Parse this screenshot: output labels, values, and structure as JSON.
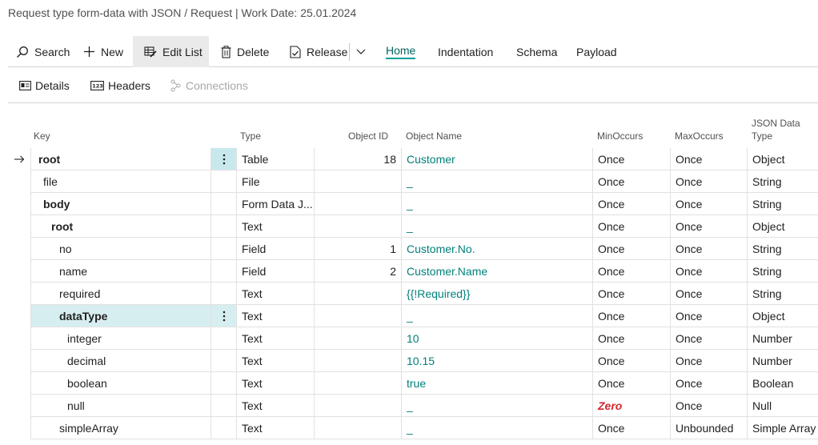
{
  "page": {
    "title": "Request type form-data with JSON / Request | Work Date: 25.01.2024"
  },
  "actions": {
    "search": "Search",
    "new": "New",
    "edit_list": "Edit List",
    "delete": "Delete",
    "release": "Release",
    "tabs": [
      "Home",
      "Indentation",
      "Schema",
      "Payload"
    ]
  },
  "subactions": {
    "details": "Details",
    "headers": "Headers",
    "connections": "Connections"
  },
  "columns": {
    "key": "Key",
    "type": "Type",
    "object_id": "Object ID",
    "object_name": "Object Name",
    "min_occurs": "MinOccurs",
    "max_occurs": "MaxOccurs",
    "json_data_type_1": "JSON Data",
    "json_data_type_2": "Type"
  },
  "rows": [
    {
      "key": "root",
      "type": "Table",
      "object_id": "18",
      "object_name": "Customer",
      "min": "Once",
      "max": "Once",
      "json": "Object"
    },
    {
      "key": "file",
      "type": "File",
      "object_id": "",
      "object_name": "_",
      "min": "Once",
      "max": "Once",
      "json": "String"
    },
    {
      "key": "body",
      "type": "Form Data J...",
      "object_id": "",
      "object_name": "_",
      "min": "Once",
      "max": "Once",
      "json": "String"
    },
    {
      "key": "root",
      "type": "Text",
      "object_id": "",
      "object_name": "_",
      "min": "Once",
      "max": "Once",
      "json": "Object"
    },
    {
      "key": "no",
      "type": "Field",
      "object_id": "1",
      "object_name": "Customer.No.",
      "min": "Once",
      "max": "Once",
      "json": "String"
    },
    {
      "key": "name",
      "type": "Field",
      "object_id": "2",
      "object_name": "Customer.Name",
      "min": "Once",
      "max": "Once",
      "json": "String"
    },
    {
      "key": "required",
      "type": "Text",
      "object_id": "",
      "object_name": "{{!Required}}",
      "min": "Once",
      "max": "Once",
      "json": "String"
    },
    {
      "key": "dataType",
      "type": "Text",
      "object_id": "",
      "object_name": "_",
      "min": "Once",
      "max": "Once",
      "json": "Object"
    },
    {
      "key": "integer",
      "type": "Text",
      "object_id": "",
      "object_name": "10",
      "min": "Once",
      "max": "Once",
      "json": "Number"
    },
    {
      "key": "decimal",
      "type": "Text",
      "object_id": "",
      "object_name": "10.15",
      "min": "Once",
      "max": "Once",
      "json": "Number"
    },
    {
      "key": "boolean",
      "type": "Text",
      "object_id": "",
      "object_name": "true",
      "min": "Once",
      "max": "Once",
      "json": "Boolean"
    },
    {
      "key": "null",
      "type": "Text",
      "object_id": "",
      "object_name": "_",
      "min": "Zero",
      "max": "Once",
      "json": "Null"
    },
    {
      "key": "simpleArray",
      "type": "Text",
      "object_id": "",
      "object_name": "_",
      "min": "Once",
      "max": "Unbounded",
      "json": "Simple Array"
    }
  ],
  "colors": {
    "accent": "#00a09a",
    "link": "#00807a",
    "selected_row": "#d7eef0",
    "zero": "#d2282e"
  }
}
